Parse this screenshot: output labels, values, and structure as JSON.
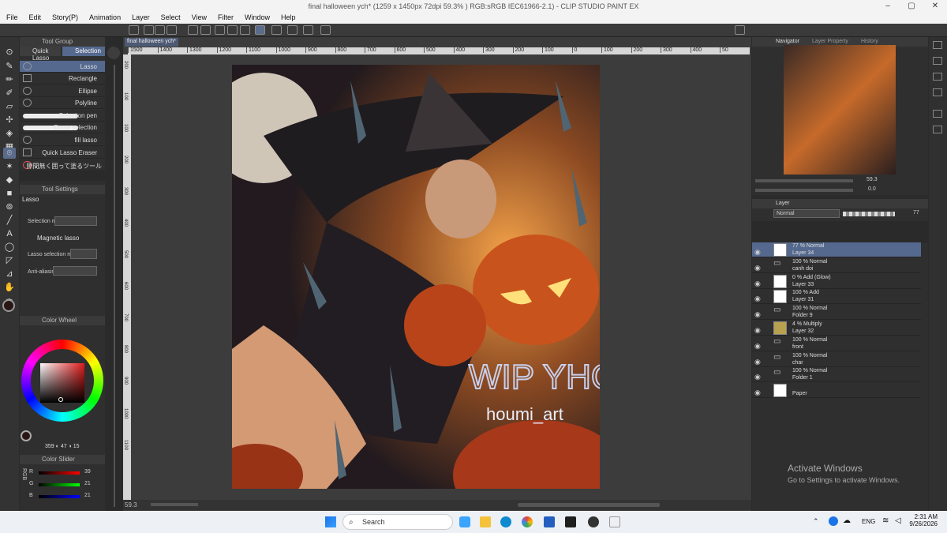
{
  "window": {
    "title": "final halloween ych* (1259 x 1450px 72dpi 59.3% ) RGB:sRGB IEC61966-2.1) - CLIP STUDIO PAINT EX"
  },
  "menu": [
    "File",
    "Edit",
    "Story(P)",
    "Animation",
    "Layer",
    "Select",
    "View",
    "Filter",
    "Window",
    "Help"
  ],
  "doc_tab": "final halloween ych*",
  "tool_group": {
    "header": "Tool Group",
    "tabs": [
      "Quick Lasso",
      "Selection"
    ],
    "subtools": [
      {
        "label": "Lasso",
        "selected": true
      },
      {
        "label": "Rectangle",
        "selected": false
      },
      {
        "label": "Ellipse",
        "selected": false
      },
      {
        "label": "Polyline",
        "selected": false
      },
      {
        "label": "Selection pen",
        "selected": false
      },
      {
        "label": "Erase selection",
        "selected": false
      },
      {
        "label": "fill lasso",
        "selected": false
      },
      {
        "label": "Quick Lasso Eraser",
        "selected": false
      },
      {
        "label": "隙間無く囲って塗るツール",
        "selected": false
      }
    ]
  },
  "tool_settings": {
    "header": "Tool Settings",
    "title": "Lasso",
    "selection_mode_label": "Selection m",
    "magnetic_label": "Magnetic lasso",
    "lasso_mode_label": "Lasso selection mode",
    "anti_alias_label": "Anti-aliasing"
  },
  "color_wheel": {
    "header": "Color Wheel",
    "hsv": [
      "359",
      "47",
      "15"
    ],
    "main_color": "#2a1515"
  },
  "color_slider": {
    "header": "Color Slider",
    "rows": [
      {
        "label": "R",
        "value": "39"
      },
      {
        "label": "G",
        "value": "21"
      },
      {
        "label": "B",
        "value": "21"
      }
    ],
    "mode_label": "RGB"
  },
  "ruler_top": [
    "1500",
    "1400",
    "1300",
    "1200",
    "1100",
    "1000",
    "900",
    "800",
    "700",
    "600",
    "500",
    "400",
    "300",
    "200",
    "100",
    "0",
    "100",
    "200",
    "300",
    "400",
    "50"
  ],
  "ruler_left": [
    "200",
    "100",
    "100",
    "200",
    "300",
    "400",
    "500",
    "600",
    "700",
    "800",
    "900",
    "1000",
    "1100"
  ],
  "canvas_overlay": {
    "watermark": "WIP YHC",
    "signature": "houmi_art"
  },
  "bottom_status": {
    "zoom": "59.3"
  },
  "navigator": {
    "tabs": [
      "Navigator",
      "Layer Property",
      "History"
    ],
    "zoom": "59.3",
    "angle": "0.0"
  },
  "layer_panel": {
    "header": "Layer",
    "blend_mode": "Normal",
    "opacity": "77",
    "layers": [
      {
        "mode": "77 % Normal",
        "name": "Layer 34",
        "thumb": "#ffffff",
        "selected": true
      },
      {
        "mode": "100 % Normal",
        "name": "canh doi",
        "thumb": "folder",
        "selected": false
      },
      {
        "mode": "0 % Add (Glow)",
        "name": "Layer 33",
        "thumb": "#ffffff",
        "selected": false
      },
      {
        "mode": "100 % Add",
        "name": "Layer 31",
        "thumb": "#ffffff",
        "selected": false
      },
      {
        "mode": "100 % Normal",
        "name": "Folder 9",
        "thumb": "folder",
        "selected": false
      },
      {
        "mode": "4 % Multiply",
        "name": "Layer 32",
        "thumb": "#b8a250",
        "selected": false
      },
      {
        "mode": "100 % Normal",
        "name": "front",
        "thumb": "folder",
        "selected": false
      },
      {
        "mode": "100 % Normal",
        "name": "char",
        "thumb": "folder",
        "selected": false
      },
      {
        "mode": "100 % Normal",
        "name": "Folder 1",
        "thumb": "folder",
        "selected": false
      },
      {
        "mode": "",
        "name": "Paper",
        "thumb": "#ffffff",
        "selected": false
      }
    ]
  },
  "activation": {
    "title": "Activate Windows",
    "subtitle": "Go to Settings to activate Windows."
  },
  "taskbar": {
    "search_placeholder": "Search",
    "lang": "ENG",
    "time": "2:31 AM",
    "date": "9/26/2026"
  }
}
